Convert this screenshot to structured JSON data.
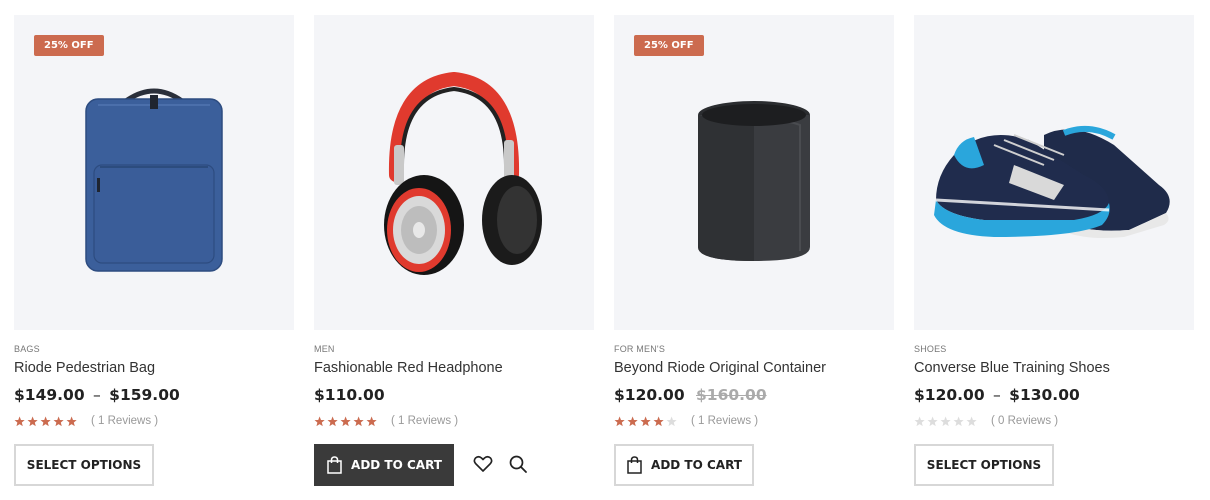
{
  "products": [
    {
      "category": "BAGS",
      "name": "Riode Pedestrian Bag",
      "price_low": "$149.00",
      "price_sep": "–",
      "price_high": "$159.00",
      "badge": "25% OFF",
      "rating": 5,
      "reviews": "( 1 Reviews )",
      "button_label": "SELECT OPTIONS",
      "image_icon": "backpack-image"
    },
    {
      "category": "MEN",
      "name": "Fashionable Red Headphone",
      "price": "$110.00",
      "rating": 5,
      "reviews": "( 1 Reviews )",
      "button_label": "ADD TO CART",
      "image_icon": "headphone-image",
      "wishlist_icon": "heart-icon",
      "quickview_icon": "search-icon"
    },
    {
      "category": "FOR MEN'S",
      "name": "Beyond Riode Original Container",
      "price": "$120.00",
      "old_price": "$160.00",
      "badge": "25% OFF",
      "rating": 4,
      "reviews": "( 1 Reviews )",
      "button_label": "ADD TO CART",
      "image_icon": "container-image"
    },
    {
      "category": "SHOES",
      "name": "Converse Blue Training Shoes",
      "price_low": "$120.00",
      "price_sep": "–",
      "price_high": "$130.00",
      "rating": 0,
      "reviews": "( 0 Reviews )",
      "button_label": "SELECT OPTIONS",
      "image_icon": "shoe-image"
    }
  ],
  "colors": {
    "accent": "#cc6b4f",
    "star_empty": "#dddddd",
    "dark_button": "#3a3a3a"
  }
}
